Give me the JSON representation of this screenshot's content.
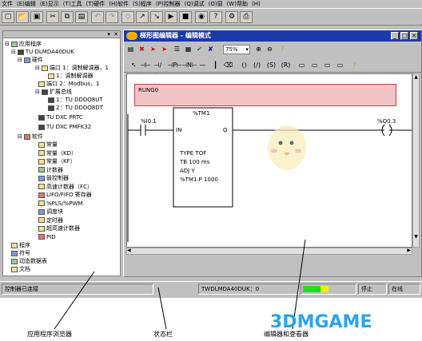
{
  "menubar": {
    "items": [
      "文件",
      "(E)编辑",
      "(E)显示",
      "(T)工具",
      "(T)硬件",
      "(H)软件",
      "(S)程序",
      "(P)控制器",
      "(Q)调试",
      "(O)窗",
      "(W)帮助",
      "(H)"
    ]
  },
  "browser": {
    "root": "应用程序",
    "controller": "TU DLMDA40DUK",
    "hardware": "硬件",
    "port1": "端口 1：调制解调器，1",
    "port1_sub": "1：调制解调器",
    "port2": "端口 2：Modbus，1",
    "ext_bus": "扩展总线",
    "ext1": "1：TU DDDO8UT",
    "ext2": "2：TU DDDO8DT",
    "unit1": "TU DXC PRTC",
    "unit2": "TU DXC PMFK32",
    "software": "软件",
    "items": [
      "常量",
      "常量（KD）",
      "常量（KF）",
      "计数器",
      "鼓控制器",
      "高速计数器（FC）",
      "LIFO/FIFO 寄存器",
      "%PLS/%PWM",
      "调度块",
      "定时器",
      "超高速计数器",
      "PID"
    ],
    "program": "程序",
    "symbols": "符号",
    "anim": "动态数据表",
    "docs": "文档"
  },
  "editor_window": {
    "title": "梯形图编辑器 - 编辑模式",
    "zoom": "75%",
    "rung_label": "RUNG0",
    "contact_label": "%I0.1",
    "coil_label": "%Q0.3",
    "block_title": "%TM1",
    "block_in": "IN",
    "block_q": "Q",
    "block_params": [
      "TYPE  TOF",
      "TB      100 ms",
      "ADJ    Y",
      "%TM1.P 1000"
    ]
  },
  "statusbar": {
    "message": "控制器已连接",
    "controller": "TWDLMDA40DUK：0",
    "state": "停止",
    "mode": "在线",
    "progress_color": "#20e020",
    "progress_color2": "#f0f000"
  },
  "captions": {
    "left": "应用程序浏览器",
    "middle": "状态栏",
    "right": "编辑器和查看器"
  },
  "watermark": "3DMGAME"
}
